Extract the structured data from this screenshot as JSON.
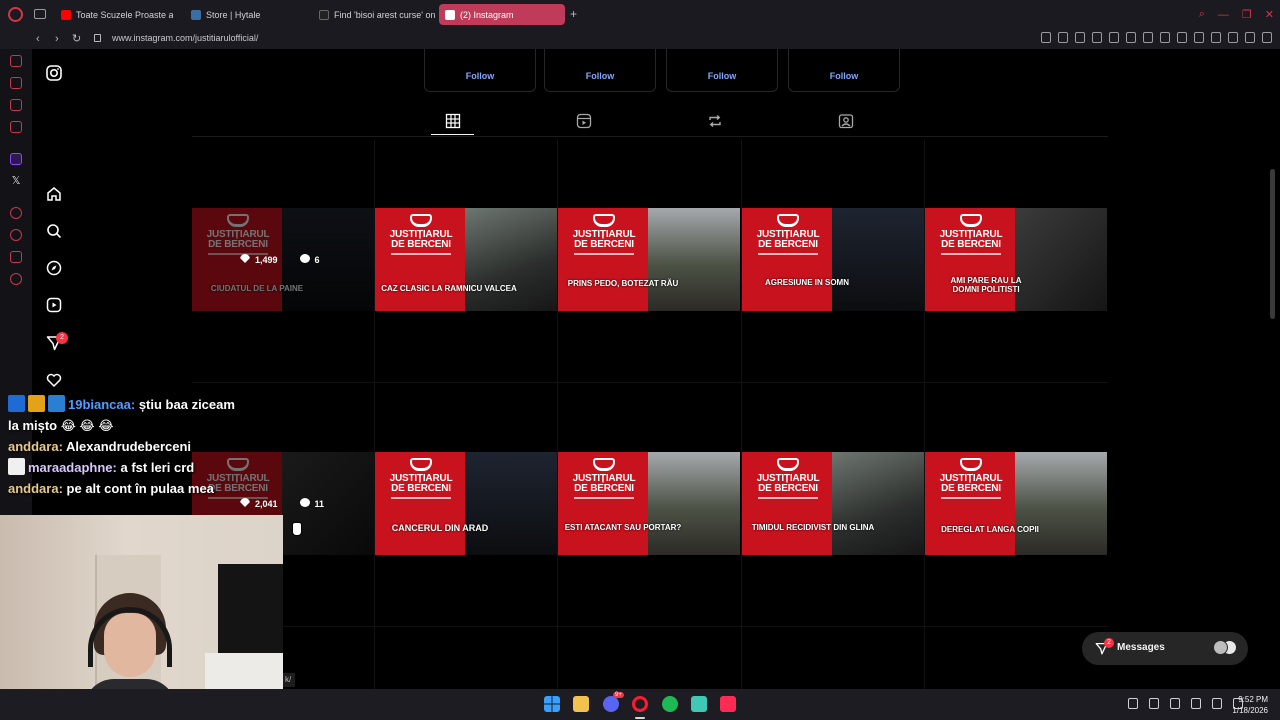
{
  "browser": {
    "tabs": [
      {
        "title": "Toate Scuzele Proaste ale",
        "favicon_color": "#ff0000"
      },
      {
        "title": "Store | Hytale",
        "favicon_color": "#3b6ea5"
      },
      {
        "title": "Find 'bisoi arest curse' on",
        "favicon_color": "#1b1a20"
      },
      {
        "title": "(2) Instagram",
        "favicon_color": "#e1306c"
      }
    ],
    "new_tab_icon": "+",
    "url": "www.instagram.com/justitiarulofficial/",
    "accent_color": "#c03a5a"
  },
  "instagram": {
    "nav": {
      "logo_icon": "instagram-icon",
      "items": [
        "home-icon",
        "search-icon",
        "explore-icon",
        "reels-icon",
        "messages-icon",
        "notifications-icon"
      ],
      "notification_count": "2"
    },
    "suggestions": [
      {
        "follow_label": "Follow"
      },
      {
        "follow_label": "Follow"
      },
      {
        "follow_label": "Follow"
      },
      {
        "follow_label": "Follow"
      }
    ],
    "profile_tabs": [
      "posts-grid-icon",
      "reels-icon",
      "reposts-icon",
      "tagged-icon"
    ],
    "posts": [
      {
        "brand": "JUSTIȚIARUL\nDE BERCENI",
        "caption": "CIUDATUL DE LA PAINE",
        "likes": "1,499",
        "comments": "6"
      },
      {
        "brand": "JUSTIȚIARUL\nDE BERCENI",
        "caption": "CAZ CLASIC LA RAMNICU VALCEA"
      },
      {
        "brand": "JUSTIȚIARUL\nDE BERCENI",
        "caption": "PRINS PEDO, BOTEZAT RĂU"
      },
      {
        "brand": "JUSTIȚIARUL\nDE BERCENI",
        "caption": "AGRESIUNE IN SOMN"
      },
      {
        "brand": "JUSTIȚIARUL\nDE BERCENI",
        "caption": "AMI PARE RAU LA\nDOMNI POLITISTI"
      },
      {
        "brand": "JUSTIȚIARUL\nDE BERCENI",
        "caption": "",
        "likes": "2,041",
        "comments": "11"
      },
      {
        "brand": "JUSTIȚIARUL\nDE BERCENI",
        "caption": "CANCERUL DIN ARAD"
      },
      {
        "brand": "JUSTIȚIARUL\nDE BERCENI",
        "caption": "ESTI ATACANT SAU PORTAR?"
      },
      {
        "brand": "JUSTIȚIARUL\nDE BERCENI",
        "caption": "TIMIDUL RECIDIVIST DIN GLINA"
      },
      {
        "brand": "JUSTIȚIARUL\nDE BERCENI",
        "caption": "DEREGLAT LANGA COPII"
      }
    ],
    "messages": {
      "label": "Messages",
      "badge": "2"
    }
  },
  "stream_chat": [
    {
      "user": "19biancaa:",
      "text": "știu baa ziceam",
      "user_color": "#4f9dff"
    },
    {
      "user": "",
      "text": "la mișto 😂 😂 😂"
    },
    {
      "user": "anddara:",
      "text": "Alexandrudeberceni",
      "user_color": "#e8c98a"
    },
    {
      "user": "maraadaphne:",
      "text": "a fst leri crd",
      "user_color": "#d8c6ff"
    },
    {
      "user": "anddara:",
      "text": "pe alt cont în pulaa mea",
      "user_color": "#e8c98a"
    }
  ],
  "status_tip": "k/",
  "system": {
    "time": "9:52 PM",
    "date": "1/18/2026",
    "discord_badge": "9+"
  }
}
